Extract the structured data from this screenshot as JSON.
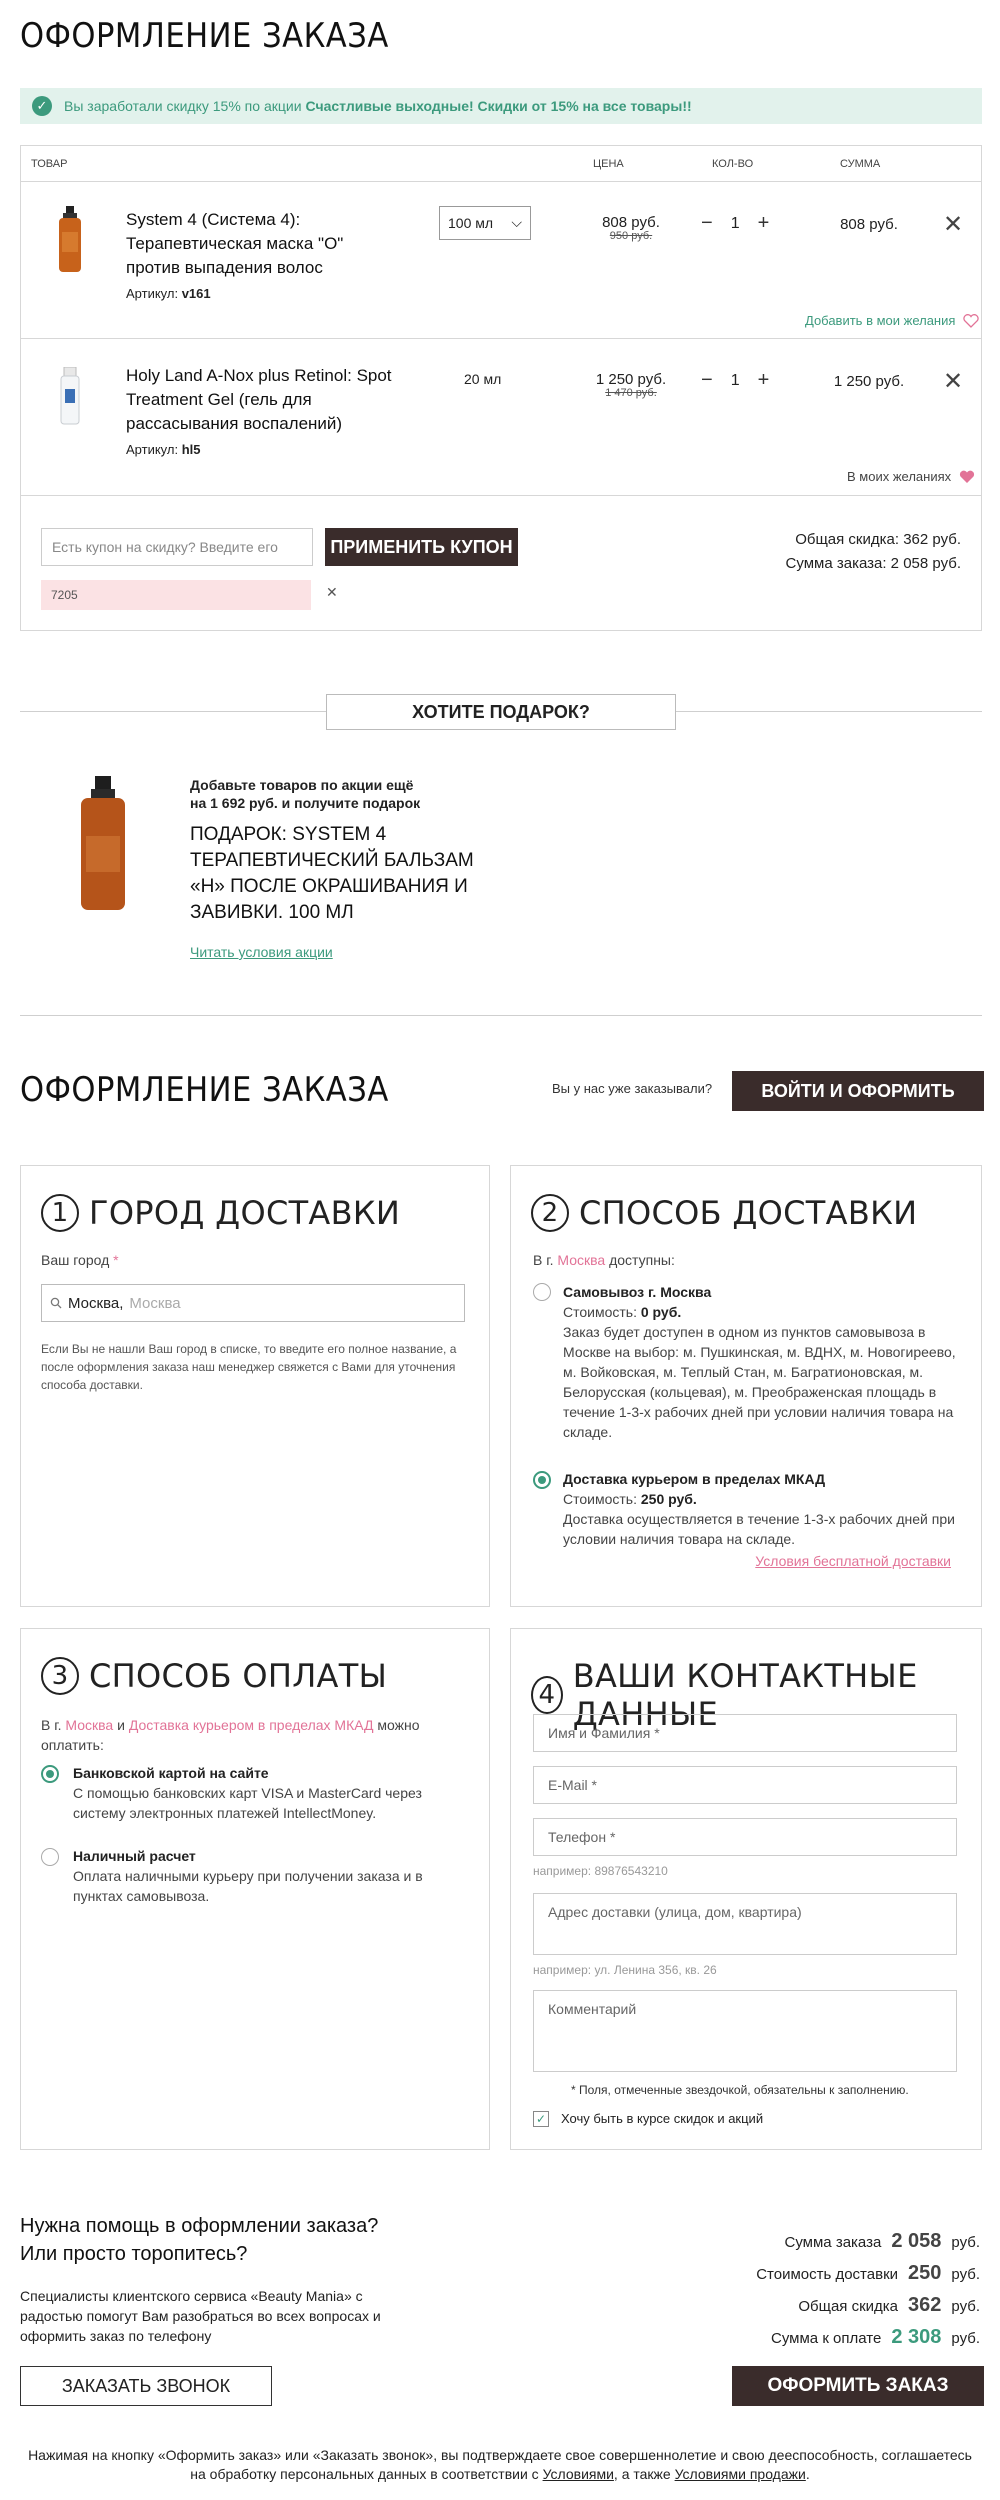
{
  "page_title": "ОФОРМЛЕНИЕ ЗАКАЗА",
  "notice": {
    "text": "Вы заработали скидку 15% по акции",
    "promo": "Счастливые выходные! Скидки от 15% на все товары!!"
  },
  "cart": {
    "headers": {
      "product": "ТОВАР",
      "price": "ЦЕНА",
      "qty": "КОЛ-ВО",
      "sum": "СУММА"
    },
    "items": [
      {
        "name": "System 4 (Система 4): Терапевтическая маска \"О\" против выпадения волос",
        "sku_label": "Артикул:",
        "sku": "v161",
        "volume": "100 мл",
        "price": "808 руб.",
        "old_price": "950 руб.",
        "qty": "1",
        "sum": "808 руб.",
        "wish": "Добавить в мои желания"
      },
      {
        "name": "Holy Land A-Nox plus Retinol: Spot Treatment Gel (гель для рассасывания воспалений)",
        "sku_label": "Артикул:",
        "sku": "hl5",
        "volume": "20 мл",
        "price": "1 250 руб.",
        "old_price": "1 470 руб.",
        "qty": "1",
        "sum": "1 250 руб.",
        "wish": "В моих желаниях"
      }
    ],
    "minus": "−",
    "plus": "+",
    "remove": "✕",
    "coupon_placeholder": "Есть купон на скидку? Введите его",
    "apply_coupon": "ПРИМЕНИТЬ КУПОН",
    "coupon_code": "7205",
    "coupon_remove": "✕",
    "total_discount": "Общая скидка: 362 руб.",
    "order_sum": "Сумма заказа: 2 058 руб."
  },
  "gift": {
    "heading": "ХОТИТЕ ПОДАРОК?",
    "add_more": "Добавьте товаров по акции ещё на 1 692 руб. и получите подарок",
    "gift_name": "ПОДАРОК: SYSTEM 4 ТЕРАПЕВТИЧЕСКИЙ БАЛЬЗАМ «Н» ПОСЛЕ ОКРАШИВАНИЯ И ЗАВИВКИ. 100 МЛ",
    "terms_link": "Читать условия акции"
  },
  "checkout": {
    "title": "ОФОРМЛЕНИЕ ЗАКАЗА",
    "already_ordered": "Вы у нас уже заказывали?",
    "login_button": "ВОЙТИ И ОФОРМИТЬ"
  },
  "city": {
    "num": "1",
    "title": "ГОРОД ДОСТАВКИ",
    "label": "Ваш город",
    "required": "*",
    "value": "Москва,",
    "placeholder_rest": "Москва",
    "help": "Если Вы не нашли Ваш город в списке, то введите его полное название, а после оформления заказа наш менеджер свяжется с Вами для уточнения способа доставки."
  },
  "delivery": {
    "num": "2",
    "title": "СПОСОБ ДОСТАВКИ",
    "in_city_prefix": "В г.",
    "city": "Москва",
    "available": "доступны:",
    "options": [
      {
        "title": "Самовывоз г. Москва",
        "cost_label": "Стоимость:",
        "cost": "0 руб.",
        "desc": "Заказ будет доступен в одном из пунктов самовывоза в Москве на выбор: м. Пушкинская, м. ВДНХ, м. Новогиреево, м. Войковская, м. Теплый Стан, м. Багратионовская, м. Белорусская (кольцевая), м. Преображенская площадь в течение 1-3-х рабочих дней при условии наличия товара на складе.",
        "selected": false
      },
      {
        "title": "Доставка курьером в пределах МКАД",
        "cost_label": "Стоимость:",
        "cost": "250 руб.",
        "desc": "Доставка осуществляется в течение 1-3-х рабочих дней при условии наличия товара на складе.",
        "selected": true
      }
    ],
    "free_link": "Условия бесплатной доставки"
  },
  "payment": {
    "num": "3",
    "title": "СПОСОБ ОПЛАТЫ",
    "intro_prefix": "В г.",
    "city": "Москва",
    "and": "и",
    "method": "Доставка курьером в пределах МКАД",
    "intro_suffix": "можно оплатить:",
    "options": [
      {
        "title": "Банковской картой на сайте",
        "desc": "С помощью банковских карт VISA и MasterCard через систему электронных платежей IntellectMoney.",
        "selected": true
      },
      {
        "title": "Наличный расчет",
        "desc": "Оплата наличными курьеру при получении заказа и в пунктах самовывоза.",
        "selected": false
      }
    ]
  },
  "contacts": {
    "num": "4",
    "title": "ВАШИ КОНТАКТНЫЕ ДАННЫЕ",
    "name_ph": "Имя и Фамилия *",
    "email_ph": "E-Mail *",
    "phone_ph": "Телефон *",
    "phone_hint": "например: 89876543210",
    "address_ph": "Адрес доставки (улица, дом, квартира)",
    "address_hint": "например: ул. Ленина 356, кв. 26",
    "comment_ph": "Комментарий",
    "required_note": "* Поля, отмеченные звездочкой, обязательны к заполнению.",
    "subscribe": "Хочу быть в курсе скидок и акций",
    "check": "✓"
  },
  "help": {
    "title1": "Нужна помощь в оформлении заказа?",
    "title2": "Или просто торопитесь?",
    "text": "Специалисты клиентского сервиса «Beauty Mania» с радостью помогут Вам разобраться во всех вопросах и оформить заказ по телефону",
    "callback": "ЗАКАЗАТЬ ЗВОНОК"
  },
  "summary": {
    "rows": [
      {
        "label": "Сумма заказа",
        "value": "2 058",
        "unit": "руб."
      },
      {
        "label": "Стоимость доставки",
        "value": "250",
        "unit": "руб."
      },
      {
        "label": "Общая скидка",
        "value": "362",
        "unit": "руб."
      },
      {
        "label": "Сумма к оплате",
        "value": "2 308",
        "unit": "руб."
      }
    ],
    "submit": "ОФОРМИТЬ ЗАКАЗ"
  },
  "footer": {
    "line1": "Нажимая на кнопку «Оформить заказ» или «Заказать звонок», вы подтверждаете свое совершеннолетие и свою дееспособность, соглашаетесь",
    "line2a": "на обработку персональных данных в соответствии с",
    "terms": "Условиями",
    "line2b": ", а также",
    "sale_terms": "Условиями продажи",
    "dot": "."
  },
  "colors": {
    "accent_green": "#3c9a7d",
    "dark_button": "#3a2c2b",
    "pink": "#e27397",
    "notice_bg": "#e2f2ec"
  }
}
